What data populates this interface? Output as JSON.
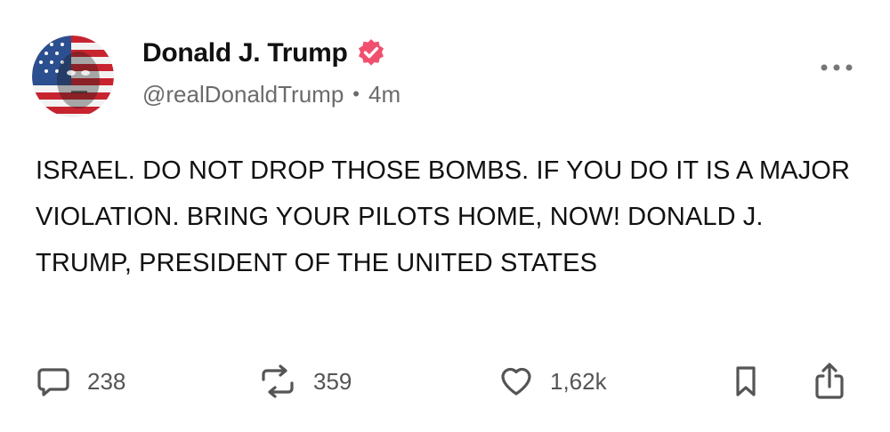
{
  "author": {
    "display_name": "Donald J. Trump",
    "handle": "@realDonaldTrump",
    "time_ago": "4m",
    "separator": "•"
  },
  "post": {
    "text": "ISRAEL. DO NOT DROP THOSE BOMBS. IF YOU DO IT IS A MAJOR VIOLATION. BRING YOUR PILOTS HOME, NOW! DONALD J. TRUMP, PRESIDENT OF THE UNITED STATES"
  },
  "actions": {
    "replies": "238",
    "reposts": "359",
    "likes": "1,62k"
  },
  "icons": {
    "verified": "verified-badge-icon",
    "more": "more-options-icon",
    "reply": "reply-bubble-icon",
    "repost": "repost-icon",
    "like": "heart-icon",
    "bookmark": "bookmark-icon",
    "share": "share-icon"
  },
  "colors": {
    "verified_badge": "#f0506e",
    "text_primary": "#111111",
    "text_secondary": "#6b6b6b",
    "icon_gray": "#555555"
  }
}
